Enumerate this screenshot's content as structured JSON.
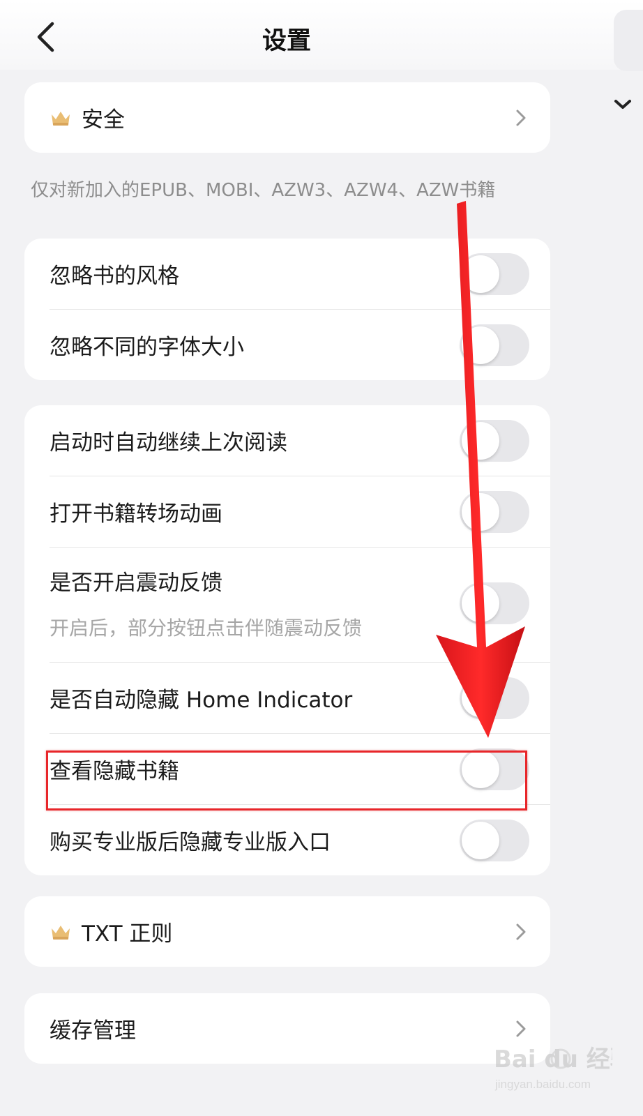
{
  "header": {
    "title": "设置"
  },
  "security": {
    "label": "安全"
  },
  "note": "仅对新加入的EPUB、MOBI、AZW3、AZW4、AZW书籍",
  "group1": [
    {
      "label": "忽略书的风格",
      "on": false
    },
    {
      "label": "忽略不同的字体大小",
      "on": false
    }
  ],
  "group2": [
    {
      "label": "启动时自动继续上次阅读",
      "on": false
    },
    {
      "label": "打开书籍转场动画",
      "on": false
    },
    {
      "label": "是否开启震动反馈",
      "sublabel": "开启后，部分按钮点击伴随震动反馈",
      "on": false
    },
    {
      "label": "是否自动隐藏 Home Indicator",
      "on": false
    },
    {
      "label": "查看隐藏书籍",
      "on": false
    },
    {
      "label": "购买专业版后隐藏专业版入口",
      "on": false
    }
  ],
  "txt_rules": {
    "label": "TXT 正则"
  },
  "cache": {
    "label": "缓存管理"
  },
  "watermark": {
    "brand": "Bai du 经验",
    "url": "jingyan.baidu.com"
  },
  "colors": {
    "accent_arrow": "#e8262a",
    "toggle_off": "#e7e7ea",
    "crown": "#e9bd73"
  }
}
